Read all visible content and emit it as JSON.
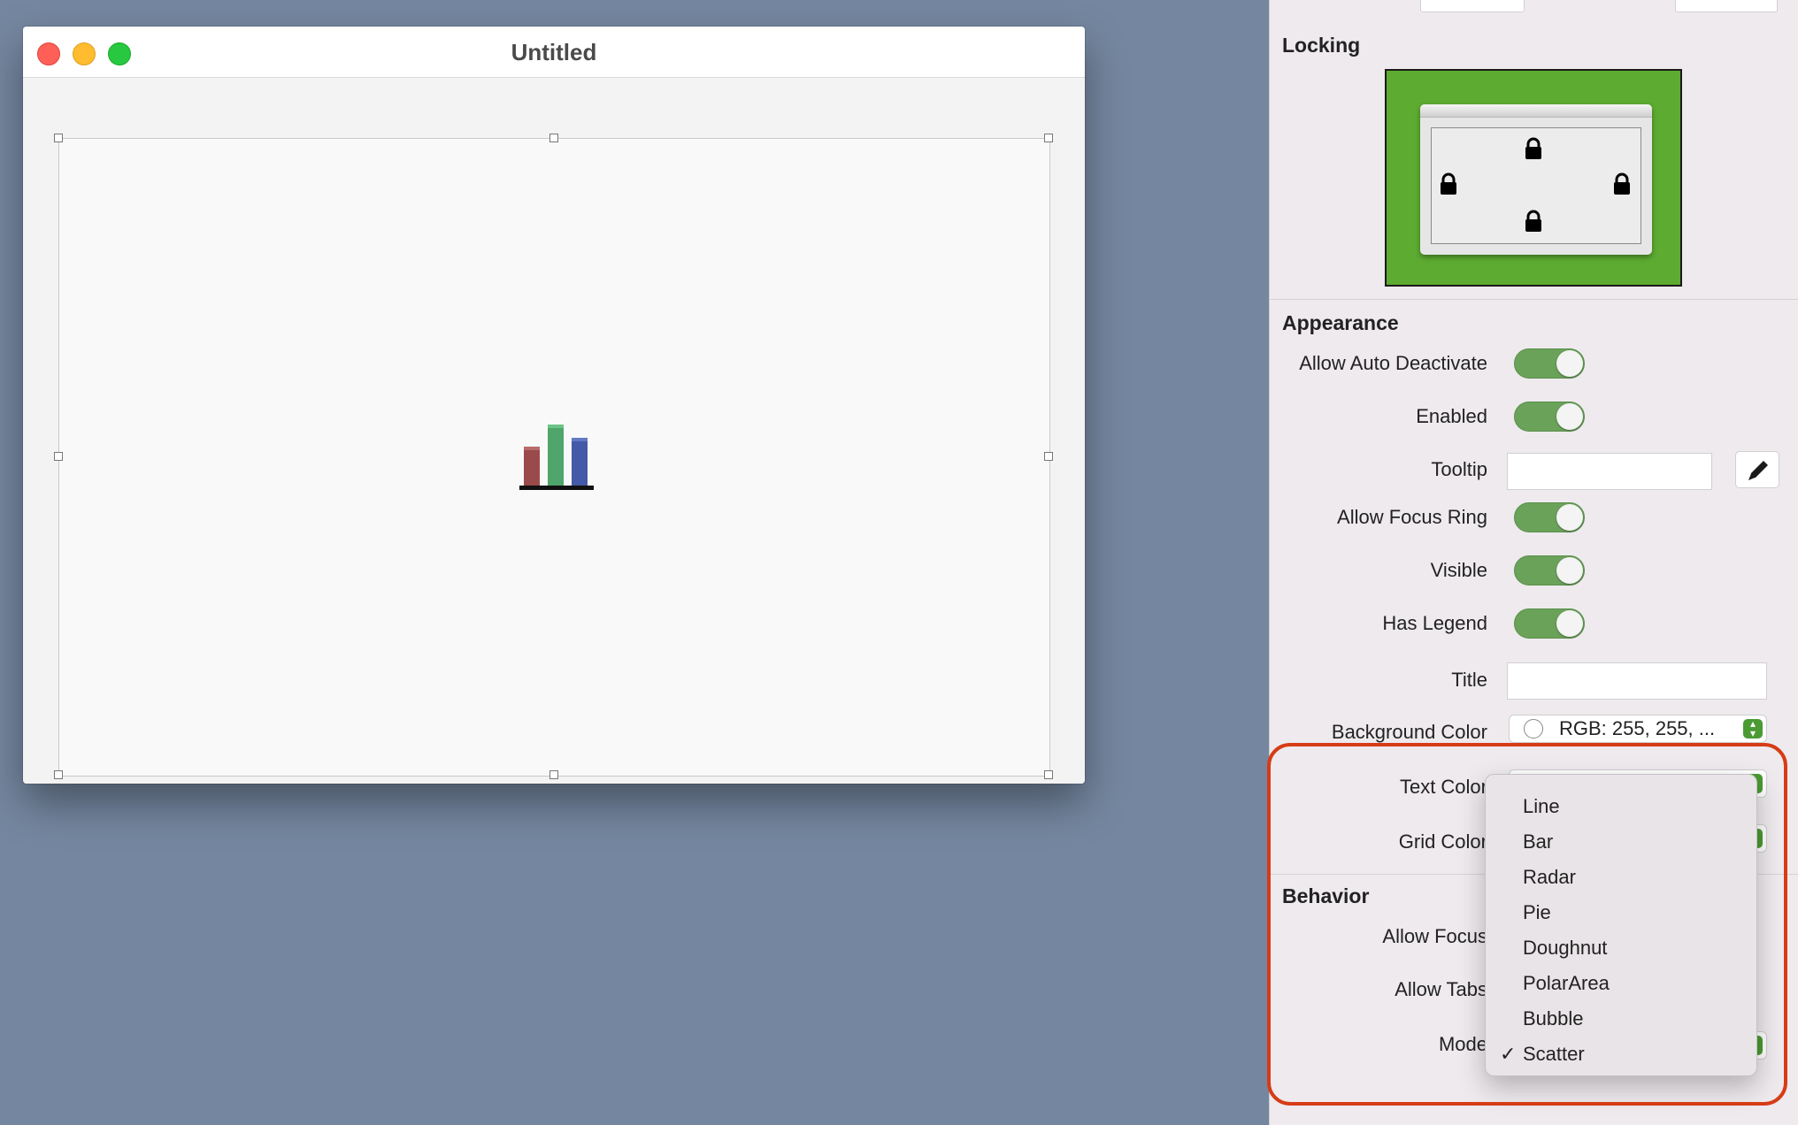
{
  "window": {
    "title": "Untitled"
  },
  "chart_icon": "bar-chart-icon",
  "inspector": {
    "locking": {
      "title": "Locking"
    },
    "appearance": {
      "title": "Appearance",
      "allow_auto_deactivate": {
        "label": "Allow Auto Deactivate",
        "on": true
      },
      "enabled": {
        "label": "Enabled",
        "on": true
      },
      "tooltip": {
        "label": "Tooltip",
        "value": ""
      },
      "allow_focus_ring": {
        "label": "Allow Focus Ring",
        "on": true
      },
      "visible": {
        "label": "Visible",
        "on": true
      },
      "has_legend": {
        "label": "Has Legend",
        "on": true
      },
      "title_field": {
        "label": "Title",
        "value": ""
      },
      "background_color": {
        "label": "Background Color",
        "value": "RGB: 255, 255, ...",
        "swatch": "#ffffff"
      },
      "text_color": {
        "label": "Text Color"
      },
      "grid_color": {
        "label": "Grid Color"
      }
    },
    "behavior": {
      "title": "Behavior",
      "allow_focus": {
        "label": "Allow Focus"
      },
      "allow_tabs": {
        "label": "Allow Tabs"
      },
      "mode": {
        "label": "Mode"
      }
    }
  },
  "mode_menu": {
    "items": [
      "Line",
      "Bar",
      "Radar",
      "Pie",
      "Doughnut",
      "PolarArea",
      "Bubble",
      "Scatter"
    ],
    "selected": "Scatter",
    "checkmark": "✓"
  },
  "colors": {
    "desktop": "#7587a0",
    "toggle_on": "#6ba25a",
    "locking_bg": "#5dab30",
    "highlight": "#d63c16"
  }
}
